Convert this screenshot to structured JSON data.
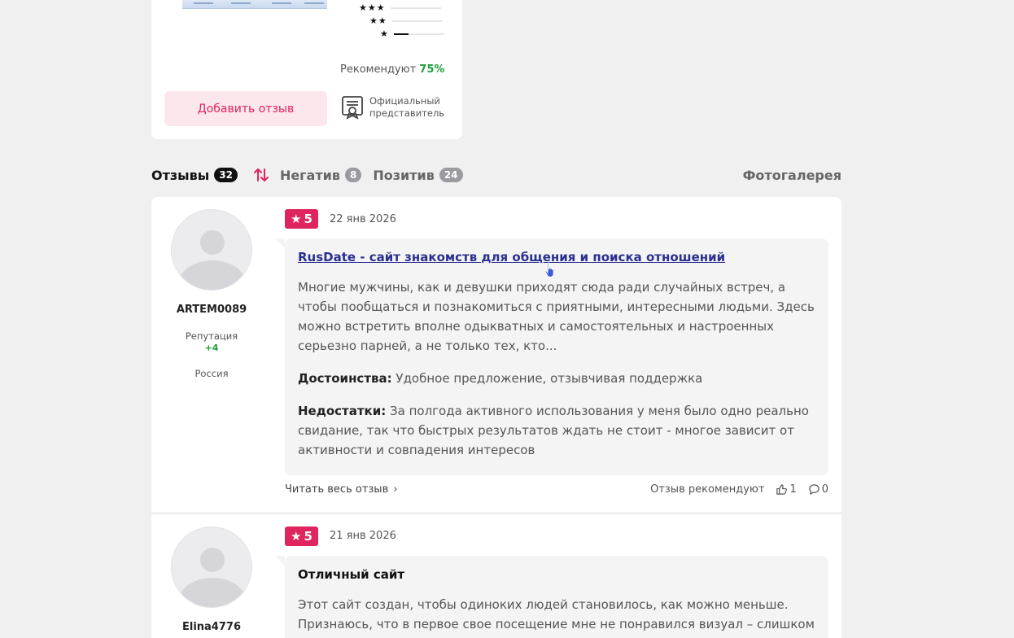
{
  "summary": {
    "rating_rows": [
      {
        "stars": "★★★",
        "fill_fraction": 0.0
      },
      {
        "stars": "★★",
        "fill_fraction": 0.0
      },
      {
        "stars": "★",
        "fill_fraction": 0.3
      }
    ],
    "recommend_label": "Рекомендуют",
    "recommend_pct": "75%",
    "add_review_label": "Добавить отзыв",
    "official_line1": "Официальный",
    "official_line2": "представитель"
  },
  "tabs": {
    "reviews_label": "Отзывы",
    "reviews_count": "32",
    "negative_label": "Негатив",
    "negative_count": "8",
    "positive_label": "Позитив",
    "positive_count": "24",
    "gallery_label": "Фотогалерея"
  },
  "reviews": [
    {
      "username": "ARTEM0089",
      "rep_label": "Репутация",
      "rep_value": "+4",
      "country": "Россия",
      "rating": "5",
      "date": "22 янв 2026",
      "title": "RusDate - сайт знакомств для общения и поиска отношений",
      "text": "Многие мужчины, как и девушки приходят сюда ради случайных встреч, а чтобы пообщаться и познакомиться с приятными, интересными людьми. Здесь можно встретить вполне одыкватных и самостоятельных и настроенных серьезно парней, а не только тех, кто...",
      "pros_label": "Достоинства:",
      "pros": "Удобное предложение, отзывчивая поддержка",
      "cons_label": "Недостатки:",
      "cons": "За полгода активного использования у меня было одно реально свидание, так что быстрых результатов ждать не стоит - многое зависит от активности и совпадения интересов",
      "read_more": "Читать весь отзыв",
      "recommend_label": "Отзыв рекомендуют",
      "likes": "1",
      "comments": "0"
    },
    {
      "username": "Elina4776",
      "rating": "5",
      "date": "21 янв 2026",
      "title": "Отличный сайт",
      "text": "Этот сайт создан, чтобы одиноких людей становилось, как можно меньше. Признаюсь, что в первое свое посещение мне не понравился визуал – слишком"
    }
  ]
}
